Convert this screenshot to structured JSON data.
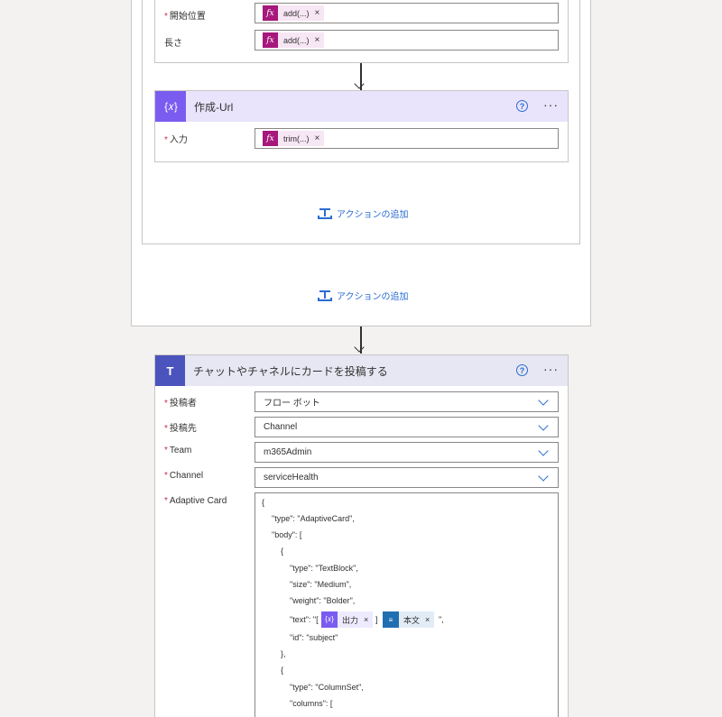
{
  "top_card": {
    "fields": [
      {
        "label": "開始位置",
        "required": true,
        "token": "add(...)"
      },
      {
        "label": "長さ",
        "required": false,
        "token": "add(...)"
      }
    ]
  },
  "compose_card": {
    "title": "作成-Url",
    "icon": "{𝑥}",
    "input_label": "入力",
    "input_token": "trim(...)"
  },
  "add_action_label": "アクションの追加",
  "teams_card": {
    "title": "チャットやチャネルにカードを投稿する",
    "fields": [
      {
        "label": "投稿者",
        "value": "フロー ボット"
      },
      {
        "label": "投稿先",
        "value": "Channel"
      },
      {
        "label": "Team",
        "value": "m365Admin"
      },
      {
        "label": "Channel",
        "value": "serviceHealth"
      }
    ],
    "adaptive_label": "Adaptive Card",
    "json_lines": [
      "{",
      "\"type\": \"AdaptiveCard\",",
      "\"body\": [",
      "{",
      "\"type\": \"TextBlock\",",
      "\"size\": \"Medium\",",
      "\"weight\": \"Bolder\",",
      "\"text\": \"[",
      "\"id\": \"subject\"",
      "},",
      "{",
      "\"type\": \"ColumnSet\",",
      "\"columns\": ["
    ],
    "text_tokens": [
      {
        "label": "出力",
        "icon": "{𝑥}"
      },
      {
        "label": "本文",
        "icon": "≡"
      }
    ],
    "text_close": "\","
  },
  "close_symbol": "×",
  "fx_symbol": "fx",
  "colors": {
    "accent": "#2b6cd1",
    "compose": "#7b5cf0",
    "teams": "#4b53bc",
    "fx": "#a6187b",
    "required": "#c4314b"
  }
}
